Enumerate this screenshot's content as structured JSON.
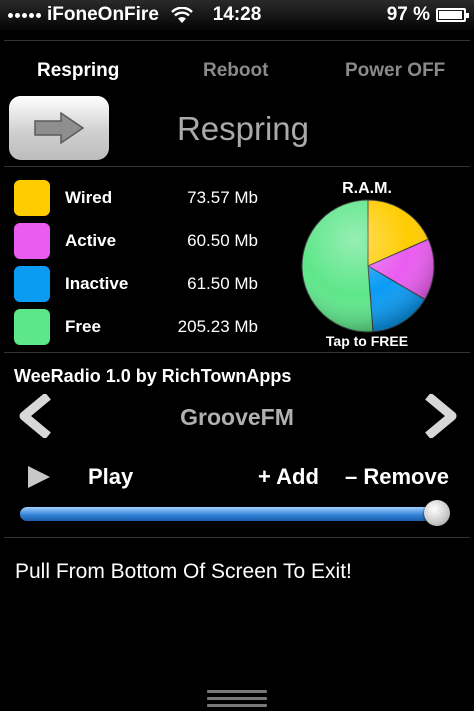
{
  "status_bar": {
    "carrier": "iFoneOnFire",
    "time": "14:28",
    "battery_text": "97 %",
    "battery_level_percent": 97
  },
  "power_tabs": [
    {
      "label": "Respring",
      "active": true
    },
    {
      "label": "Reboot",
      "active": false
    },
    {
      "label": "Power OFF",
      "active": false
    }
  ],
  "respring": {
    "title": "Respring",
    "button_icon": "arrow-right-icon"
  },
  "ram": {
    "title": "R.A.M.",
    "caption": "Tap to FREE",
    "rows": [
      {
        "label": "Wired",
        "value": "73.57 Mb",
        "color": "#FFCC00"
      },
      {
        "label": "Active",
        "value": "60.50 Mb",
        "color": "#E95CF0"
      },
      {
        "label": "Inactive",
        "value": "61.50 Mb",
        "color": "#0A9BF5"
      },
      {
        "label": "Free",
        "value": "205.23 Mb",
        "color": "#5EE68A"
      }
    ],
    "values_mb": [
      73.57,
      60.5,
      61.5,
      205.23
    ]
  },
  "radio": {
    "title": "WeeRadio 1.0 by RichTownApps",
    "station": "GrooveFM",
    "play_label": "Play",
    "add_label": "+ Add",
    "remove_label": "– Remove",
    "volume_fraction": 0.97
  },
  "exit_hint": "Pull From Bottom Of Screen To Exit!"
}
